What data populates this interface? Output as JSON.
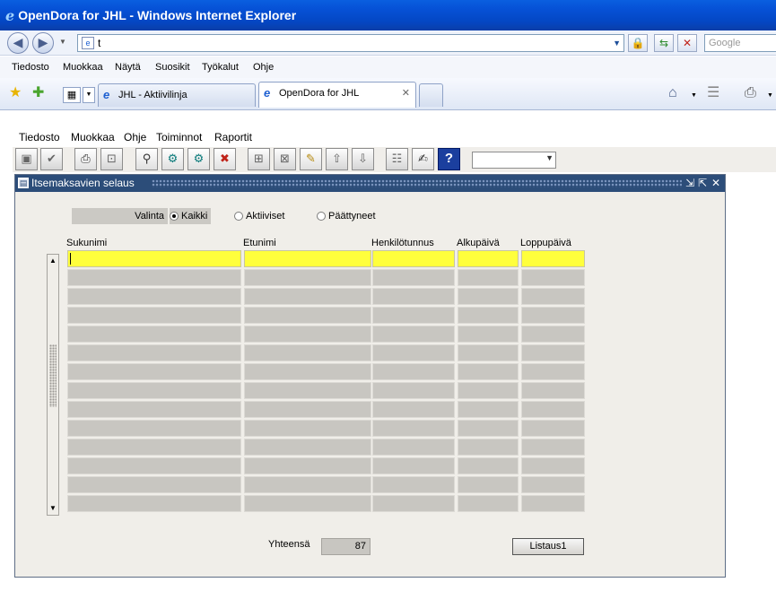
{
  "browser": {
    "title": "OpenDora for JHL - Windows Internet Explorer",
    "address": "t",
    "search_placeholder": "Google",
    "menu": [
      "Tiedosto",
      "Muokkaa",
      "Näytä",
      "Suosikit",
      "Työkalut",
      "Ohje"
    ],
    "tabs": [
      {
        "label": "JHL - Aktiivilinja"
      },
      {
        "label": "OpenDora for JHL"
      }
    ]
  },
  "app": {
    "menu": [
      "Tiedosto",
      "Muokkaa",
      "Ohje",
      "Toiminnot",
      "Raportit"
    ],
    "help_symbol": "?",
    "window": {
      "title": "Itsemaksavien selaus",
      "valinta_label": "Valinta",
      "radio_options": [
        {
          "label": "Kaikki",
          "selected": true
        },
        {
          "label": "Aktiiviset",
          "selected": false
        },
        {
          "label": "Päättyneet",
          "selected": false
        }
      ],
      "columns": [
        "Sukunimi",
        "Etunimi",
        "Henkilötunnus",
        "Alkupäivä",
        "Loppupäivä"
      ],
      "row_count": 14,
      "total_label": "Yhteensä",
      "total_value": "87",
      "listaus_button": "Listaus1"
    }
  }
}
